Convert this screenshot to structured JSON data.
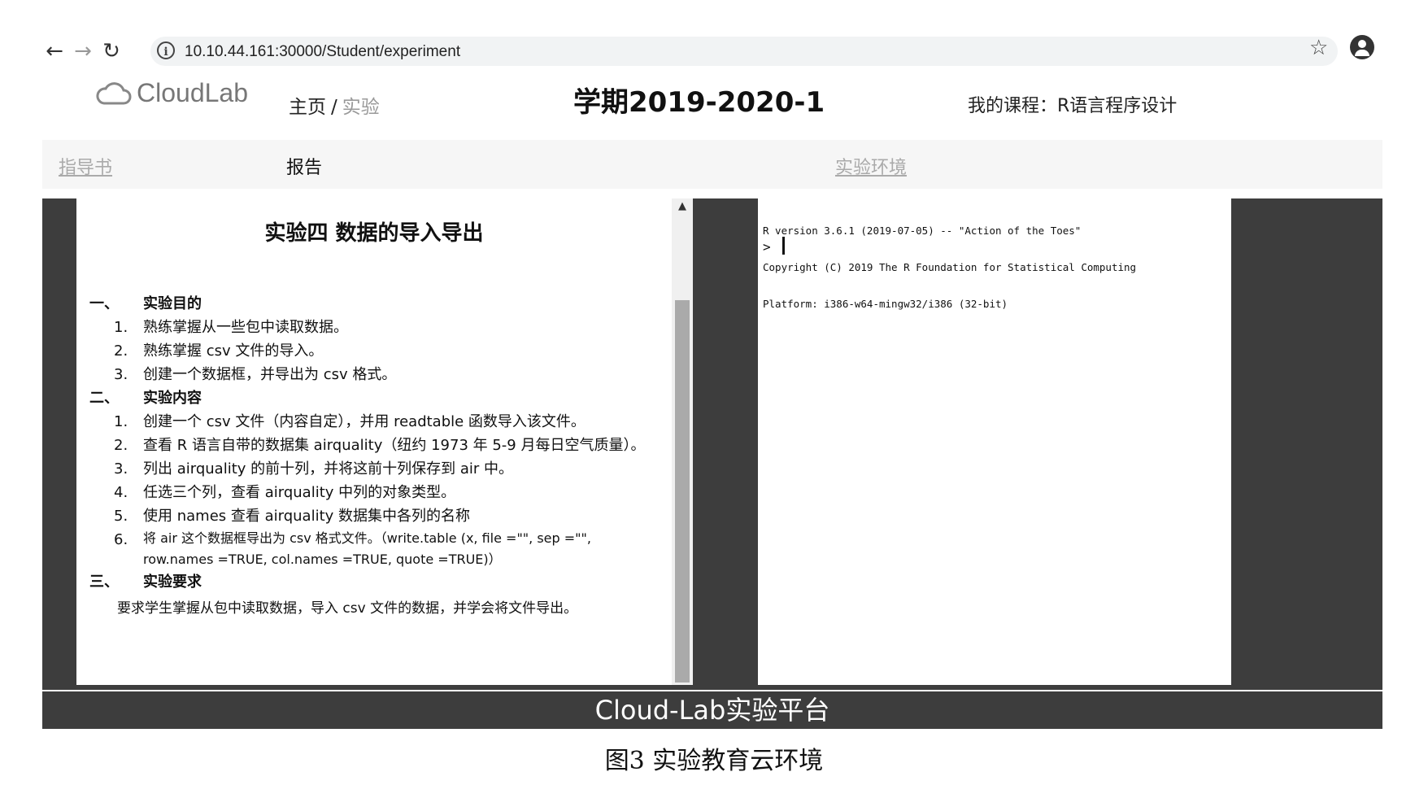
{
  "browser": {
    "url": "10.10.44.161:30000/Student/experiment",
    "back_icon": "←",
    "forward_icon": "→",
    "reload_icon": "↻",
    "info_icon": "i",
    "bookmark_icon": "☆"
  },
  "header": {
    "logo_text": "CloudLab",
    "breadcrumb": {
      "home": "主页",
      "separator": "/",
      "current": "实验"
    },
    "semester": "学期2019-2020-1",
    "course": "我的课程：R语言程序设计"
  },
  "tabs": [
    {
      "label": "指导书"
    },
    {
      "label": "报告"
    },
    {
      "label": "实验环境"
    }
  ],
  "document": {
    "title": "实验四  数据的导入导出",
    "sections": [
      {
        "num": "一、",
        "title": "实验目的",
        "items": [
          {
            "n": "1.",
            "text": "熟练掌握从一些包中读取数据。"
          },
          {
            "n": "2.",
            "text": "熟练掌握 csv 文件的导入。"
          },
          {
            "n": "3.",
            "text": "创建一个数据框，并导出为 csv 格式。"
          }
        ]
      },
      {
        "num": "二、",
        "title": "实验内容",
        "items": [
          {
            "n": "1.",
            "text": "创建一个 csv 文件（内容自定），并用 readtable 函数导入该文件。"
          },
          {
            "n": "2.",
            "text": "查看 R 语言自带的数据集 airquality（纽约 1973 年 5-9 月每日空气质量）。"
          },
          {
            "n": "3.",
            "text": "列出 airquality 的前十列，并将这前十列保存到 air 中。"
          },
          {
            "n": "4.",
            "text": "任选三个列，查看 airquality 中列的对象类型。"
          },
          {
            "n": "5.",
            "text": "使用 names 查看 airquality 数据集中各列的名称"
          },
          {
            "n": "6.",
            "text": "将 air 这个数据框导出为 csv 格式文件。（write.table (x, file =\"\", sep =\"\", row.names =TRUE, col.names =TRUE, quote =TRUE)）"
          }
        ]
      },
      {
        "num": "三、",
        "title": "实验要求",
        "text": "要求学生掌握从包中读取数据，导入 csv 文件的数据，并学会将文件导出。"
      }
    ]
  },
  "console": {
    "lines": [
      "R version 3.6.1 (2019-07-05) -- \"Action of the Toes\"",
      "Copyright (C) 2019 The R Foundation for Statistical Computing",
      "Platform: i386-w64-mingw32/i386 (32-bit)"
    ],
    "prompt": ">"
  },
  "footer": {
    "platform": "Cloud-Lab实验平台"
  },
  "caption": "图3   实验教育云环境"
}
